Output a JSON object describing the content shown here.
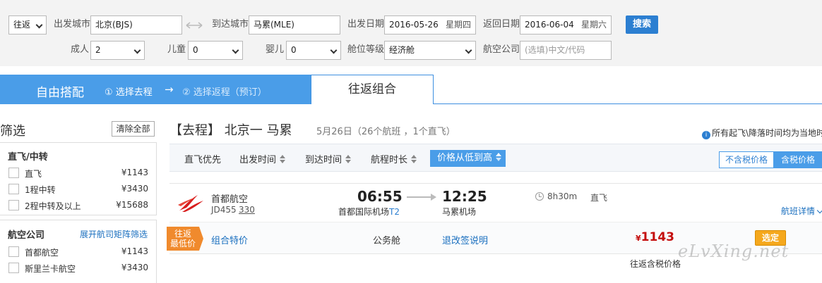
{
  "search": {
    "trip_type": "往返",
    "depart_city_label": "出发城市",
    "depart_city_value": "北京(BJS)",
    "swap_icon": "swap-icon",
    "arrive_city_label": "到达城市",
    "arrive_city_value": "马累(MLE)",
    "depart_date_label": "出发日期",
    "depart_date_value": "2016-05-26",
    "depart_weekday": "星期四",
    "return_date_label": "返回日期",
    "return_date_value": "2016-06-04",
    "return_weekday": "星期六",
    "search_button": "搜索",
    "adult_label": "成人",
    "adult_value": "2",
    "child_label": "儿童",
    "child_value": "0",
    "infant_label": "婴儿",
    "infant_value": "0",
    "cabin_label": "舱位等级",
    "cabin_value": "经济舱",
    "airline_label": "航空公司",
    "airline_placeholder": "(选填)中文/代码"
  },
  "tabs": {
    "free_title": "自由搭配",
    "step1": "① 选择去程",
    "arrow": "→",
    "step2": "② 选择返程（预订）",
    "combo": "往返组合"
  },
  "sidebar": {
    "title": "筛选",
    "clear_all": "清除全部",
    "stops": {
      "heading": "直飞/中转",
      "items": [
        {
          "label": "直飞",
          "price": "¥1143"
        },
        {
          "label": "1程中转",
          "price": "¥3430"
        },
        {
          "label": "2程中转及以上",
          "price": "¥15688"
        }
      ]
    },
    "airlines": {
      "heading": "航空公司",
      "expand_link": "展开航司矩阵筛选",
      "items": [
        {
          "label": "首都航空",
          "price": "¥1143"
        },
        {
          "label": "斯里兰卡航空",
          "price": "¥3430"
        }
      ]
    }
  },
  "main": {
    "route_title": "【去程】 北京一 马累",
    "route_sub": "5月26日（26个航班 ，1个直飞）",
    "tax_note": "所有起飞\\降落时间均为当地时",
    "sort": {
      "direct_first": "直飞优先",
      "depart_time": "出发时间",
      "arrive_time": "到达时间",
      "duration": "航程时长",
      "price_low_high": "价格从低到高"
    },
    "tax_toggle": {
      "excl": "不含税价格",
      "incl": "含税价格"
    },
    "flight": {
      "airline": "首都航空",
      "flight_no": "JD455",
      "aircraft": "330",
      "dep_time": "06:55",
      "dep_airport": "首都国际机场",
      "dep_terminal": "T2",
      "arr_time": "12:25",
      "arr_airport": "马累机场",
      "duration": "8h30m",
      "direct": "直飞",
      "details_link": "航班详情",
      "fare": {
        "badge_line1": "往返",
        "badge_line2": "最低价",
        "name": "组合特价",
        "cabin": "公务舱",
        "rules": "退改签说明",
        "currency": "¥",
        "price": "1143",
        "select": "选定",
        "note": "往返含税价格"
      }
    }
  },
  "watermark": "eLvXing.net",
  "colors": {
    "accent_blue": "#4a9de8",
    "price_red": "#c40f0f",
    "badge_orange": "#f08a2d",
    "select_yellow": "#f5a81d"
  }
}
